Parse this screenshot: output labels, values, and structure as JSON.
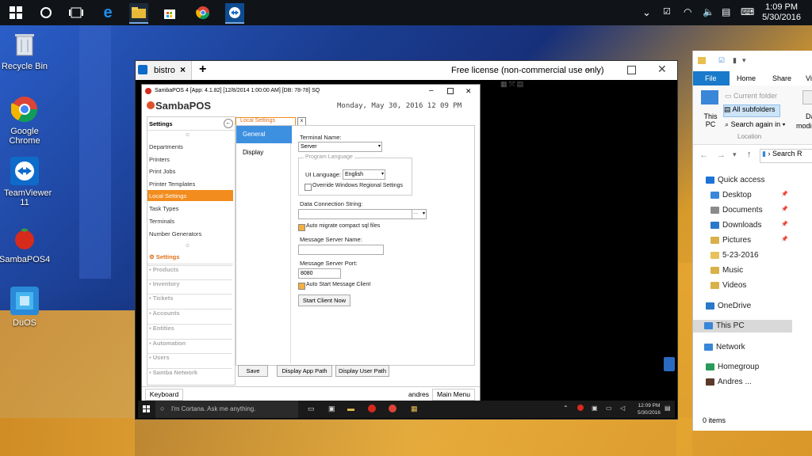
{
  "taskbar": {
    "clock_time": "1:09 PM",
    "clock_date": "5/30/2016"
  },
  "desktop_icons": [
    {
      "label": "Recycle Bin"
    },
    {
      "label": "Google Chrome"
    },
    {
      "label": "TeamViewer 11"
    },
    {
      "label": "SambaPOS4"
    },
    {
      "label": "DuOS"
    }
  ],
  "teamviewer": {
    "tab_label": "bistro",
    "license_text": "Free license (non-commercial use only)"
  },
  "sambapos": {
    "title": "SambaPOS 4 [App: 4.1.82] [12/8/2014 1:00:00 AM] [DB: 78-78] SQ",
    "logo": "SambaPOS",
    "datetime": "Monday, May 30, 2016 12 09 PM",
    "settings_header": "Settings",
    "sidebar_items": [
      "Departments",
      "Printers",
      "Print Jobs",
      "Printer Templates",
      "Local Settings",
      "Task Types",
      "Terminals",
      "Number Generators"
    ],
    "sections": [
      "Settings",
      "Products",
      "Inventory",
      "Tickets",
      "Accounts",
      "Entities",
      "Automation",
      "Users",
      "Samba Network"
    ],
    "tab_label": "Local Settings",
    "tab_close": "x",
    "subnav": [
      "General",
      "Display"
    ],
    "terminal_name_label": "Terminal Name:",
    "terminal_name_value": "Server",
    "program_language_label": "Program Language",
    "ui_language_label": "UI Language:",
    "ui_language_value": "English",
    "override_label": "Override Windows Regional Settings",
    "data_conn_label": "Data Connection String:",
    "data_conn_value": "",
    "auto_migrate_label": "Auto migrate compact sql files",
    "msg_server_name_label": "Message Server Name:",
    "msg_server_name_value": "",
    "msg_server_port_label": "Message Server Port:",
    "msg_server_port_value": "8080",
    "auto_start_label": "Auto Start Message Client",
    "start_client_button": "Start Client Now",
    "save_button": "Save",
    "display_app_path_button": "Display App Path",
    "display_user_path_button": "Display User Path",
    "keyboard_button": "Keyboard",
    "user_name": "andres",
    "main_menu_button": "Main Menu"
  },
  "inner_taskbar": {
    "cortana_placeholder": "I'm Cortana. Ask me anything.",
    "clock_time": "12:09 PM",
    "clock_date": "5/30/2016"
  },
  "explorer": {
    "ribbon_tabs": [
      "File",
      "Home",
      "Share",
      "Vi"
    ],
    "current_folder": "Current folder",
    "all_subfolders": "All subfolders",
    "search_again_in": "Search again in",
    "this_pc_label": "This PC",
    "location_label": "Location",
    "da_label": "Da",
    "modi_label": "modi",
    "search_label": "Search R",
    "nav": [
      {
        "label": "Quick access",
        "color": "#1e73d6"
      },
      {
        "label": "Desktop",
        "color": "#3a86d8"
      },
      {
        "label": "Documents",
        "color": "#8b8b8b"
      },
      {
        "label": "Downloads",
        "color": "#2a78c9"
      },
      {
        "label": "Pictures",
        "color": "#d8b14a"
      },
      {
        "label": "5-23-2016",
        "color": "#e8c15c"
      },
      {
        "label": "Music",
        "color": "#d8b14a"
      },
      {
        "label": "Videos",
        "color": "#d8b14a"
      },
      {
        "label": "OneDrive",
        "color": "#2a78c9"
      },
      {
        "label": "This PC",
        "color": "#3a86d8"
      },
      {
        "label": "Network",
        "color": "#3a86d8"
      },
      {
        "label": "Homegroup",
        "color": "#2a9a5a"
      },
      {
        "label": "Andres ...",
        "color": "#5a3a2a"
      }
    ],
    "status": "0 items"
  }
}
